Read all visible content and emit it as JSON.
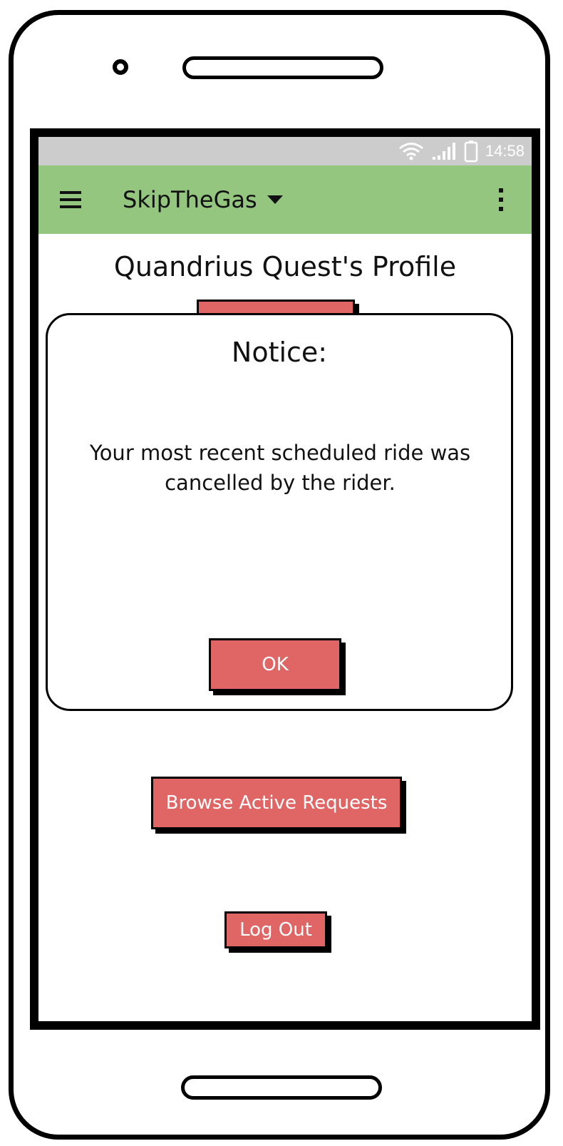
{
  "status_bar": {
    "time": "14:58",
    "icons": [
      "wifi-icon",
      "signal-icon",
      "battery-icon"
    ]
  },
  "app_bar": {
    "title": "SkipTheGas",
    "icons": [
      "menu-icon",
      "dropdown-arrow-icon",
      "more-vert-icon"
    ],
    "color": "#94c67f"
  },
  "profile": {
    "title": "Quandrius Quest's Profile"
  },
  "dialog": {
    "title": "Notice:",
    "message": "Your most recent scheduled ride was cancelled by the rider.",
    "ok_label": "OK"
  },
  "actions": {
    "browse_label": "Browse Active Requests",
    "logout_label": "Log Out"
  },
  "colors": {
    "button": "#e06666",
    "status_bar": "#cccccc"
  }
}
